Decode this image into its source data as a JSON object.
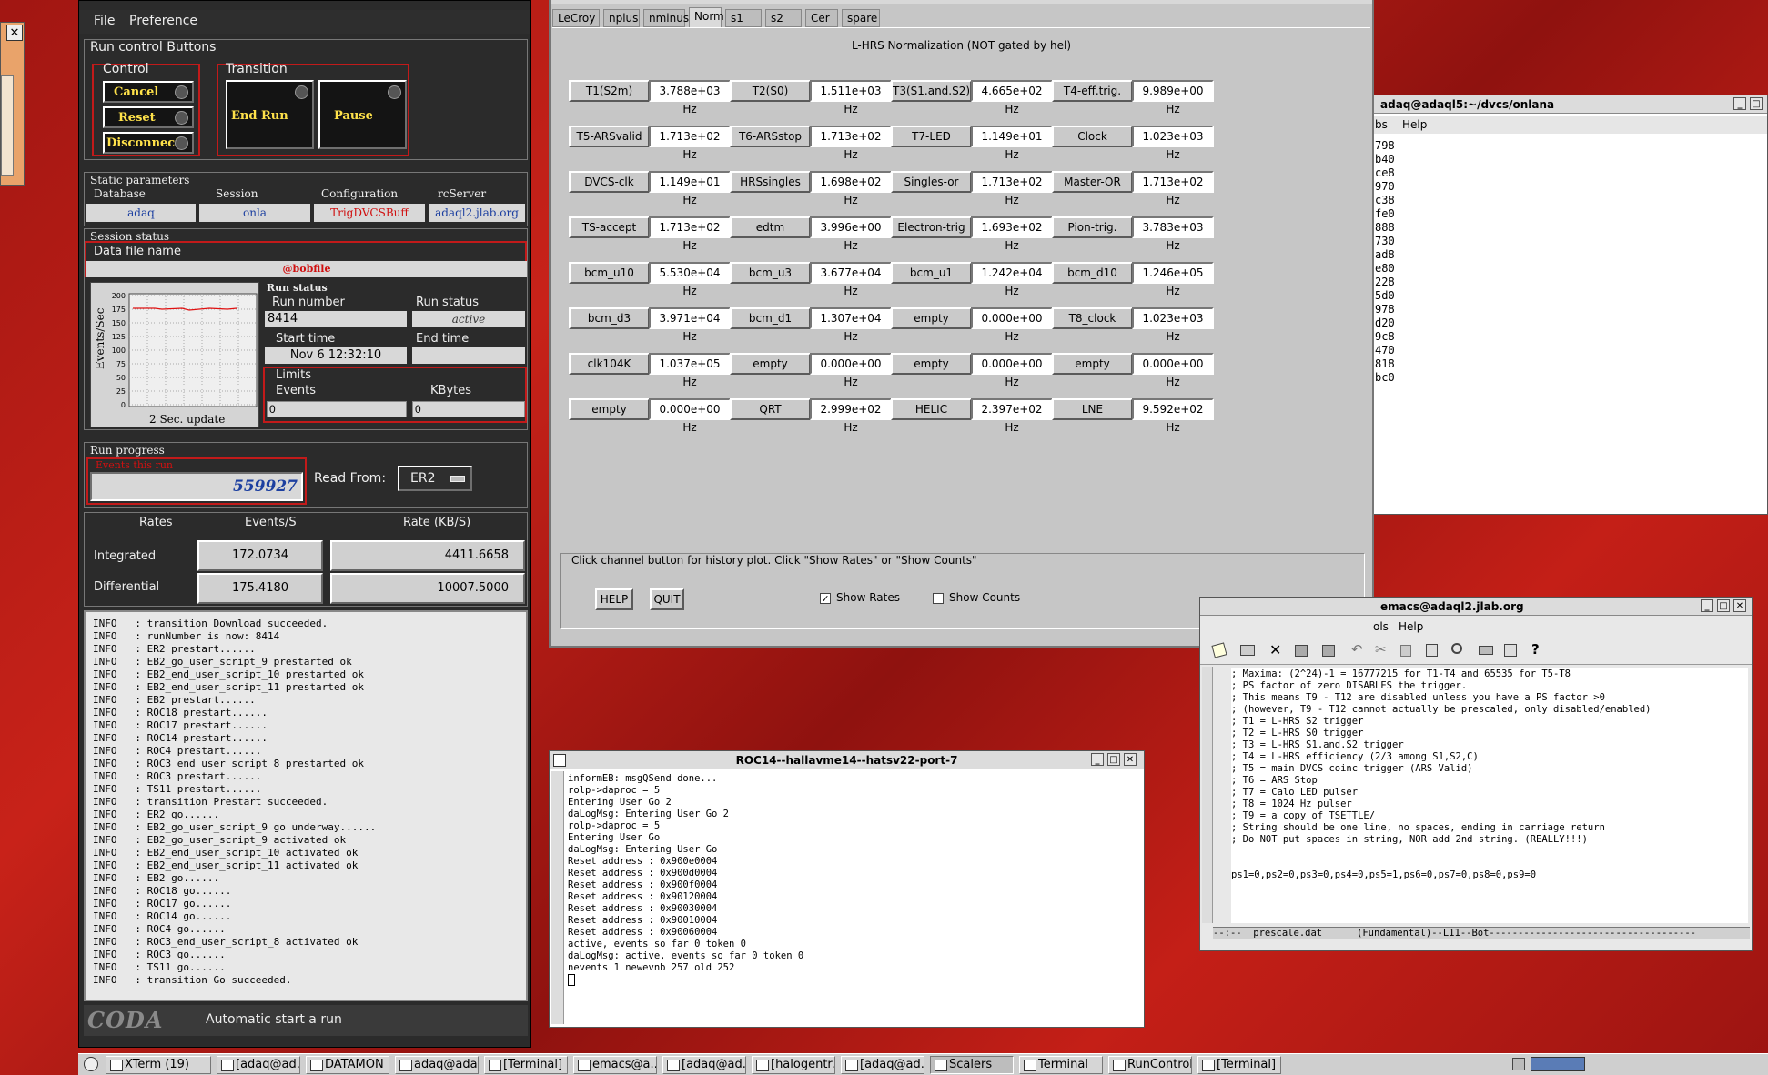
{
  "left_window": {
    "close_glyph": "✕"
  },
  "runcontrol": {
    "menu": [
      "File",
      "Preference"
    ],
    "run_control_title": "Run control Buttons",
    "control_title": "Control",
    "control_buttons": [
      "Cancel",
      "Reset",
      "Disconnect"
    ],
    "transition_title": "Transition",
    "transition_buttons": [
      "End Run",
      "Pause"
    ],
    "static_title": "Static parameters",
    "static_headers": [
      "Database",
      "Session",
      "Configuration",
      "rcServer"
    ],
    "static_values": [
      "adaq",
      "onla",
      "TrigDVCSBuff",
      "adaql2.jlab.org"
    ],
    "session_status_title": "Session status",
    "data_file_label": "Data file name",
    "data_file_value": "@bobfile",
    "plot": {
      "ylabel": "Events/Sec",
      "xlabel": "2 Sec. update",
      "yticks": [
        "200",
        "175",
        "150",
        "125",
        "100",
        "75",
        "50",
        "25",
        "0"
      ]
    },
    "run_status_title": "Run status",
    "run_number_label": "Run number",
    "run_number": "8414",
    "run_status_label": "Run status",
    "run_status_value": "active",
    "start_time_label": "Start time",
    "start_time_value": "Nov 6 12:32:10",
    "end_time_label": "End time",
    "end_time_value": "",
    "limits_label": "Limits",
    "events_label": "Events",
    "events_value": "0",
    "kbytes_label": "KBytes",
    "kbytes_value": "0",
    "run_progress_title": "Run progress",
    "events_this_run_label": "Events this run",
    "events_this_run_value": "559927",
    "read_from_label": "Read From:",
    "read_from_value": "ER2",
    "rates_headers": [
      "Rates",
      "Events/S",
      "Rate (KB/S)"
    ],
    "rates_rows": [
      {
        "label": "Integrated",
        "events": "172.0734",
        "rate": "4411.6658"
      },
      {
        "label": "Differential",
        "events": "175.4180",
        "rate": "10007.5000"
      }
    ],
    "log": [
      "INFO   : transition Download succeeded.",
      "INFO   : runNumber is now: 8414",
      "INFO   : ER2 prestart......",
      "INFO   : EB2_go_user_script_9 prestarted ok",
      "INFO   : EB2_end_user_script_10 prestarted ok",
      "INFO   : EB2_end_user_script_11 prestarted ok",
      "INFO   : EB2 prestart......",
      "INFO   : ROC18 prestart......",
      "INFO   : ROC17 prestart......",
      "INFO   : ROC14 prestart......",
      "INFO   : ROC4 prestart......",
      "INFO   : ROC3_end_user_script_8 prestarted ok",
      "INFO   : ROC3 prestart......",
      "INFO   : TS11 prestart......",
      "INFO   : transition Prestart succeeded.",
      "INFO   : ER2 go......",
      "INFO   : EB2_go_user_script_9 go underway......",
      "INFO   : EB2_go_user_script_9 activated ok",
      "INFO   : EB2_end_user_script_10 activated ok",
      "INFO   : EB2_end_user_script_11 activated ok",
      "INFO   : EB2 go......",
      "INFO   : ROC18 go......",
      "INFO   : ROC17 go......",
      "INFO   : ROC14 go......",
      "INFO   : ROC4 go......",
      "INFO   : ROC3_end_user_script_8 activated ok",
      "INFO   : ROC3 go......",
      "INFO   : TS11 go......",
      "INFO   : transition Go succeeded."
    ],
    "coda_logo": "CODA",
    "footer_status": "Automatic start a run"
  },
  "scaler": {
    "tabs": [
      "LeCroy",
      "nplus",
      "nminus",
      "Norm",
      "s1",
      "s2",
      "Cer",
      "spare"
    ],
    "active_tab": "Norm",
    "title": "L-HRS Normalization (NOT gated by hel)",
    "rows": [
      [
        [
          "T1(S2m)",
          "3.788e+03 Hz"
        ],
        [
          "T2(S0)",
          "1.511e+03 Hz"
        ],
        [
          "T3(S1.and.S2)",
          "4.665e+02 Hz"
        ],
        [
          "T4-eff.trig.",
          "9.989e+00 Hz"
        ]
      ],
      [
        [
          "T5-ARSvalid",
          "1.713e+02 Hz"
        ],
        [
          "T6-ARSstop",
          "1.713e+02 Hz"
        ],
        [
          "T7-LED",
          "1.149e+01 Hz"
        ],
        [
          "Clock",
          "1.023e+03 Hz"
        ]
      ],
      [
        [
          "DVCS-clk",
          "1.149e+01 Hz"
        ],
        [
          "HRSsingles",
          "1.698e+02 Hz"
        ],
        [
          "Singles-or",
          "1.713e+02 Hz"
        ],
        [
          "Master-OR",
          "1.713e+02 Hz"
        ]
      ],
      [
        [
          "TS-accept",
          "1.713e+02 Hz"
        ],
        [
          "edtm",
          "3.996e+00 Hz"
        ],
        [
          "Electron-trig",
          "1.693e+02 Hz"
        ],
        [
          "Pion-trig.",
          "3.783e+03 Hz"
        ]
      ],
      [
        [
          "bcm_u10",
          "5.530e+04 Hz"
        ],
        [
          "bcm_u3",
          "3.677e+04 Hz"
        ],
        [
          "bcm_u1",
          "1.242e+04 Hz"
        ],
        [
          "bcm_d10",
          "1.246e+05 Hz"
        ]
      ],
      [
        [
          "bcm_d3",
          "3.971e+04 Hz"
        ],
        [
          "bcm_d1",
          "1.307e+04 Hz"
        ],
        [
          "empty",
          "0.000e+00 Hz"
        ],
        [
          "T8_clock",
          "1.023e+03 Hz"
        ]
      ],
      [
        [
          "clk104K",
          "1.037e+05 Hz"
        ],
        [
          "empty",
          "0.000e+00 Hz"
        ],
        [
          "empty",
          "0.000e+00 Hz"
        ],
        [
          "empty",
          "0.000e+00 Hz"
        ]
      ],
      [
        [
          "empty",
          "0.000e+00 Hz"
        ],
        [
          "QRT",
          "2.999e+02 Hz"
        ],
        [
          "HELIC",
          "2.397e+02 Hz"
        ],
        [
          "LNE",
          "9.592e+02 Hz"
        ]
      ]
    ],
    "hint": "Click channel button for history plot.  Click \"Show Rates\" or \"Show Counts\"",
    "help_label": "HELP",
    "quit_label": "QUIT",
    "show_rates_label": "Show Rates",
    "show_rates_checked": true,
    "show_counts_label": "Show Counts",
    "show_counts_checked": false
  },
  "xterm_right": {
    "title": "adaq@adaql5:~/dvcs/onlana",
    "menu": [
      "bs",
      "Help"
    ],
    "lines": [
      "798",
      "b40",
      "ce8",
      "970",
      "c38",
      "fe0",
      "888",
      "730",
      "ad8",
      "e80",
      "228",
      "5d0",
      "978",
      "d20",
      "9c8",
      "470",
      "818",
      "bc0"
    ]
  },
  "roc_term": {
    "title": "ROC14--hallavme14--hatsv22-port-7",
    "lines": [
      "informEB: msgQSend done...",
      "rolp->daproc = 5",
      "Entering User Go 2",
      "daLogMsg: Entering User Go 2",
      "rolp->daproc = 5",
      "Entering User Go",
      "daLogMsg: Entering User Go",
      "Reset address : 0x900e0004",
      "Reset address : 0x900d0004",
      "Reset address : 0x900f0004",
      "Reset address : 0x90120004",
      "Reset address : 0x90030004",
      "Reset address : 0x90010004",
      "Reset address : 0x90060004",
      "active, events so far 0 token 0",
      "daLogMsg: active, events so far 0 token 0",
      "nevents 1 newevnb 257 old 252"
    ]
  },
  "emacs": {
    "title": "emacs@adaql2.jlab.org",
    "menu": [
      "ols",
      "Help"
    ],
    "lines": [
      "; Maxima: (2^24)-1 = 16777215 for T1-T4 and 65535 for T5-T8",
      "; PS factor of zero DISABLES the trigger.",
      "; This means T9 - T12 are disabled unless you have a PS factor >0",
      "; (however, T9 - T12 cannot actually be prescaled, only disabled/enabled)",
      "; T1 = L-HRS S2 trigger",
      "; T2 = L-HRS S0 trigger",
      "; T3 = L-HRS S1.and.S2 trigger",
      "; T4 = L-HRS efficiency (2/3 among S1,S2,C)",
      "; T5 = main DVCS coinc trigger (ARS Valid)",
      "; T6 = ARS Stop",
      "; T7 = Calo LED pulser",
      "; T8 = 1024 Hz pulser",
      "; T9 = a copy of TSETTLE/",
      "; String should be one line, no spaces, ending in carriage return",
      "; Do NOT put spaces in string, NOR add 2nd string. (REALLY!!!)",
      "",
      "",
      "ps1=0,ps2=0,ps3=0,ps4=0,ps5=1,ps6=0,ps7=0,ps8=0,ps9=0"
    ],
    "modeline": "--:--  prescale.dat      (Fundamental)--L11--Bot------------------------------------"
  },
  "taskbar": {
    "items": [
      {
        "label": "XTerm (19)",
        "active": false
      },
      {
        "label": "[adaq@ad...",
        "active": false
      },
      {
        "label": "DATAMON ...",
        "active": false
      },
      {
        "label": "adaq@ada...",
        "active": false
      },
      {
        "label": "[Terminal]",
        "active": false
      },
      {
        "label": "emacs@a...",
        "active": false
      },
      {
        "label": "[adaq@ad...",
        "active": false
      },
      {
        "label": "[halogentr...",
        "active": false
      },
      {
        "label": "[adaq@ad...",
        "active": false
      },
      {
        "label": "Scalers",
        "active": true
      },
      {
        "label": "Terminal",
        "active": false
      },
      {
        "label": "RunControl",
        "active": false
      },
      {
        "label": "[Terminal]",
        "active": false
      }
    ]
  }
}
